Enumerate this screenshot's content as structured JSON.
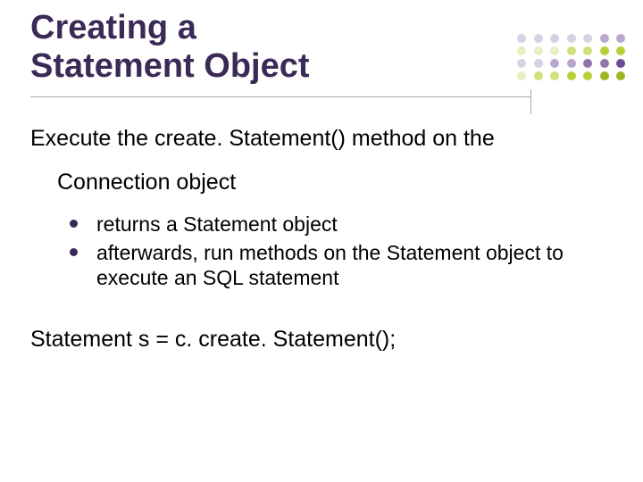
{
  "title_line1": "Creating a",
  "title_line2": "Statement Object",
  "lead": "Execute the create. Statement() method on the",
  "lead_cont": "Connection object",
  "bullets": [
    "returns a Statement object",
    "afterwards, run methods on the Statement object to execute an SQL statement"
  ],
  "code_line": "Statement s = c. create. Statement();",
  "dot_colors": {
    "row1": [
      "#d9d0e3",
      "#d9d0e3",
      "#d9d0e3",
      "#d9d0e3",
      "#d9d0e3",
      "#b9a7cf",
      "#b9a7cf"
    ],
    "row2": [
      "#e6efc2",
      "#e6efc2",
      "#e6efc2",
      "#d2e07a",
      "#d2e07a",
      "#b9cf3a",
      "#b9cf3a"
    ],
    "row3": [
      "#d9d0e3",
      "#d9d0e3",
      "#b9a7cf",
      "#b9a7cf",
      "#8e75ad",
      "#8e75ad",
      "#6a4e93"
    ],
    "row4": [
      "#e6efc2",
      "#d2e07a",
      "#d2e07a",
      "#b9cf3a",
      "#b9cf3a",
      "#9bb724",
      "#9bb724"
    ]
  }
}
